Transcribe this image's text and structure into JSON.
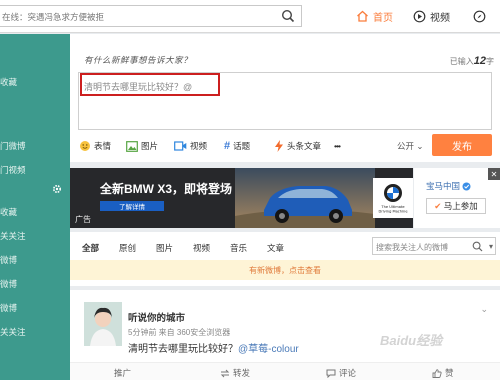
{
  "topbar": {
    "search_placeholder": "在线：突遇冯急求方便被拒",
    "nav": {
      "home": "首页",
      "video": "视频"
    }
  },
  "sidebar": {
    "items": [
      "收藏",
      "门微博",
      "门视频",
      "收藏",
      "关关注",
      "微博",
      "微博",
      "微博",
      "关关注"
    ]
  },
  "compose": {
    "title": "有什么新鲜事想告诉大家？",
    "count_prefix": "已输入",
    "count_value": "12",
    "count_suffix": "字",
    "text": "清明节去哪里玩比较好？@",
    "tools": [
      "表情",
      "图片",
      "视频",
      "话题",
      "头条文章",
      "•••"
    ],
    "visibility": "公开",
    "publish": "发布"
  },
  "ad": {
    "title": "全新BMW X3，即将登场",
    "button": "了解详情",
    "label": "广告",
    "brand_line1": "The Ultimate",
    "brand_line2": "Driving Machine",
    "accent": "#1a5fc3"
  },
  "weibo_card": {
    "name": "宝马中国",
    "follow": "马上参加"
  },
  "feed": {
    "tabs": [
      "全部",
      "原创",
      "图片",
      "视频",
      "音乐",
      "文章"
    ],
    "search_placeholder": "搜索我关注人的微博",
    "new_posts": "有新微博，点击查看"
  },
  "post": {
    "user": "听说你的城市",
    "meta": "5分钟前 来自 360安全浏览器",
    "text": "清明节去哪里玩比较好？",
    "mention": "@草莓-colour",
    "actions": [
      "推广",
      "转发",
      "评论",
      "赞"
    ]
  },
  "watermark": "Baidu经验",
  "colors": {
    "orange": "#ff8140",
    "teal": "#3d9a8d",
    "highlight": "#cc1f1f"
  }
}
